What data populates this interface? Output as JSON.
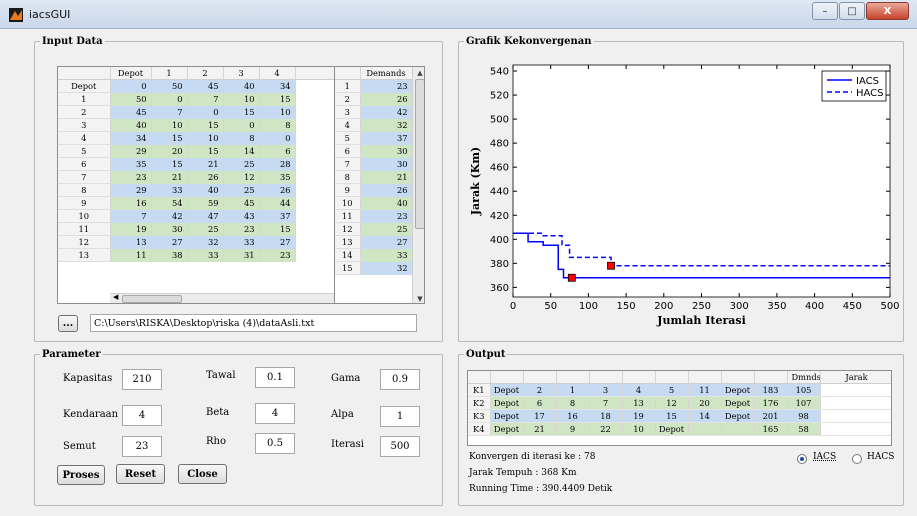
{
  "window": {
    "title": "iacsGUI",
    "minimize": "–",
    "maximize": "□",
    "close": "X"
  },
  "input_panel": {
    "title": "Input Data",
    "matrix": {
      "headers": [
        "Depot",
        "1",
        "2",
        "3",
        "4"
      ],
      "rows": [
        [
          "Depot",
          "0",
          "50",
          "45",
          "40",
          "34"
        ],
        [
          "1",
          "50",
          "0",
          "7",
          "10",
          "15"
        ],
        [
          "2",
          "45",
          "7",
          "0",
          "15",
          "10"
        ],
        [
          "3",
          "40",
          "10",
          "15",
          "0",
          "8"
        ],
        [
          "4",
          "34",
          "15",
          "10",
          "8",
          "0"
        ],
        [
          "5",
          "29",
          "20",
          "15",
          "14",
          "6"
        ],
        [
          "6",
          "35",
          "15",
          "21",
          "25",
          "28"
        ],
        [
          "7",
          "23",
          "21",
          "26",
          "12",
          "35"
        ],
        [
          "8",
          "29",
          "33",
          "40",
          "25",
          "26"
        ],
        [
          "9",
          "16",
          "54",
          "59",
          "45",
          "44"
        ],
        [
          "10",
          "7",
          "42",
          "47",
          "43",
          "37"
        ],
        [
          "11",
          "19",
          "30",
          "25",
          "23",
          "15"
        ],
        [
          "12",
          "13",
          "27",
          "32",
          "33",
          "27"
        ],
        [
          "13",
          "11",
          "38",
          "33",
          "31",
          "23"
        ]
      ]
    },
    "demands": {
      "header": "Demands",
      "rows": [
        [
          "1",
          "23"
        ],
        [
          "2",
          "26"
        ],
        [
          "3",
          "42"
        ],
        [
          "4",
          "32"
        ],
        [
          "5",
          "37"
        ],
        [
          "6",
          "30"
        ],
        [
          "7",
          "30"
        ],
        [
          "8",
          "21"
        ],
        [
          "9",
          "26"
        ],
        [
          "10",
          "40"
        ],
        [
          "11",
          "23"
        ],
        [
          "12",
          "25"
        ],
        [
          "13",
          "27"
        ],
        [
          "14",
          "33"
        ],
        [
          "15",
          "32"
        ]
      ]
    },
    "browse_label": "...",
    "file_path": "C:\\Users\\RISKA\\Desktop\\riska (4)\\dataAsli.txt"
  },
  "chart_panel": {
    "title": "Grafik Kekonvergenan"
  },
  "chart_data": {
    "type": "line",
    "xlabel": "Jumlah Iterasi",
    "ylabel": "Jarak (Km)",
    "xlim": [
      0,
      500
    ],
    "ylim": [
      352,
      545
    ],
    "xticks": [
      0,
      50,
      100,
      150,
      200,
      250,
      300,
      350,
      400,
      450,
      500
    ],
    "yticks": [
      360,
      380,
      400,
      420,
      440,
      460,
      480,
      500,
      520,
      540
    ],
    "legend_position": "top-right",
    "grid": false,
    "series": [
      {
        "name": "IACS",
        "style": "solid",
        "color": "#0000ff",
        "x": [
          0,
          20,
          20,
          40,
          40,
          60,
          60,
          67,
          67,
          78,
          78,
          500
        ],
        "y": [
          405,
          405,
          398,
          398,
          395,
          395,
          375,
          375,
          368,
          368,
          368,
          368
        ]
      },
      {
        "name": "HACS",
        "style": "dashed",
        "color": "#0000ff",
        "x": [
          0,
          40,
          40,
          65,
          65,
          75,
          75,
          130,
          130,
          500
        ],
        "y": [
          405,
          405,
          403,
          403,
          395,
          395,
          385,
          385,
          378,
          378
        ]
      }
    ],
    "markers": [
      {
        "x": 78,
        "y": 368,
        "color": "#ff0000"
      },
      {
        "x": 130,
        "y": 378,
        "color": "#ff0000"
      }
    ]
  },
  "parameter_panel": {
    "title": "Parameter",
    "fields": [
      {
        "label": "Kapasitas",
        "value": "210"
      },
      {
        "label": "Tawal",
        "value": "0.1"
      },
      {
        "label": "Gama",
        "value": "0.9"
      },
      {
        "label": "Kendaraan",
        "value": "4"
      },
      {
        "label": "Beta",
        "value": "4"
      },
      {
        "label": "Alpa",
        "value": "1"
      },
      {
        "label": "Semut",
        "value": "23"
      },
      {
        "label": "Rho",
        "value": "0.5"
      },
      {
        "label": "Iterasi",
        "value": "500"
      }
    ],
    "buttons": {
      "proses": "Proses",
      "reset": "Reset",
      "close": "Close"
    }
  },
  "output_panel": {
    "title": "Output",
    "headers": [
      "",
      "",
      "",
      "",
      "",
      "",
      "",
      "",
      "",
      "Dmnds",
      "Jarak"
    ],
    "rows": [
      [
        "K1",
        "Depot",
        "2",
        "1",
        "3",
        "4",
        "5",
        "11",
        "Depot",
        "183",
        "105"
      ],
      [
        "K2",
        "Depot",
        "6",
        "8",
        "7",
        "13",
        "12",
        "20",
        "Depot",
        "176",
        "107"
      ],
      [
        "K3",
        "Depot",
        "17",
        "16",
        "18",
        "19",
        "15",
        "14",
        "Depot",
        "201",
        "98"
      ],
      [
        "K4",
        "Depot",
        "21",
        "9",
        "22",
        "10",
        "Depot",
        "",
        "",
        "165",
        "58"
      ]
    ],
    "konvergen": "Konvergen di iterasi ke : 78",
    "jarak": "Jarak Tempuh : 368 Km",
    "running": "Running Time : 390.4409 Detik",
    "radio_iacs": "IACS",
    "radio_hacs": "HACS"
  }
}
